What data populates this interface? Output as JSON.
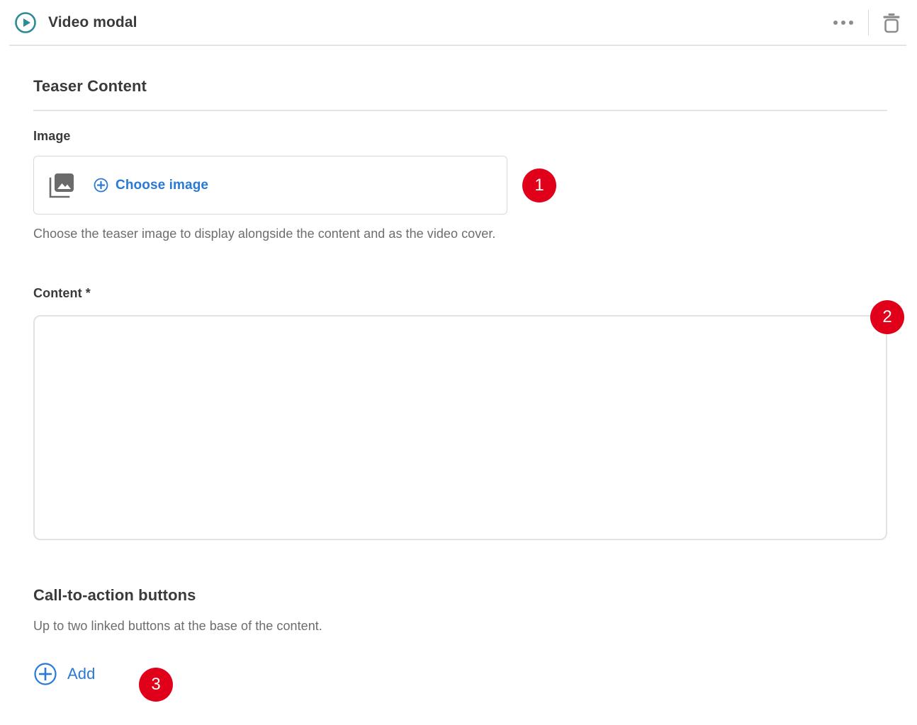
{
  "header": {
    "title": "Video modal",
    "play_icon": "play-circle-icon",
    "more_icon": "more-options-icon",
    "delete_icon": "trash-icon",
    "accent_color": "#2e8b96"
  },
  "section": {
    "title": "Teaser Content"
  },
  "image_field": {
    "label": "Image",
    "thumb_icon": "image-placeholder-icon",
    "plus_icon": "plus-circle-icon",
    "choose_label": "Choose image",
    "helper_text": "Choose the teaser image to display alongside the content and as the video cover.",
    "link_color": "#2979d6"
  },
  "content_field": {
    "label": "Content *",
    "value": "",
    "placeholder": ""
  },
  "cta_section": {
    "title": "Call-to-action buttons",
    "description": "Up to two linked buttons at the base of the content.",
    "add_label": "Add",
    "add_icon": "plus-circle-icon"
  },
  "badges": [
    {
      "number": "1",
      "color": "#e00019"
    },
    {
      "number": "2",
      "color": "#e00019"
    },
    {
      "number": "3",
      "color": "#e00019"
    }
  ]
}
